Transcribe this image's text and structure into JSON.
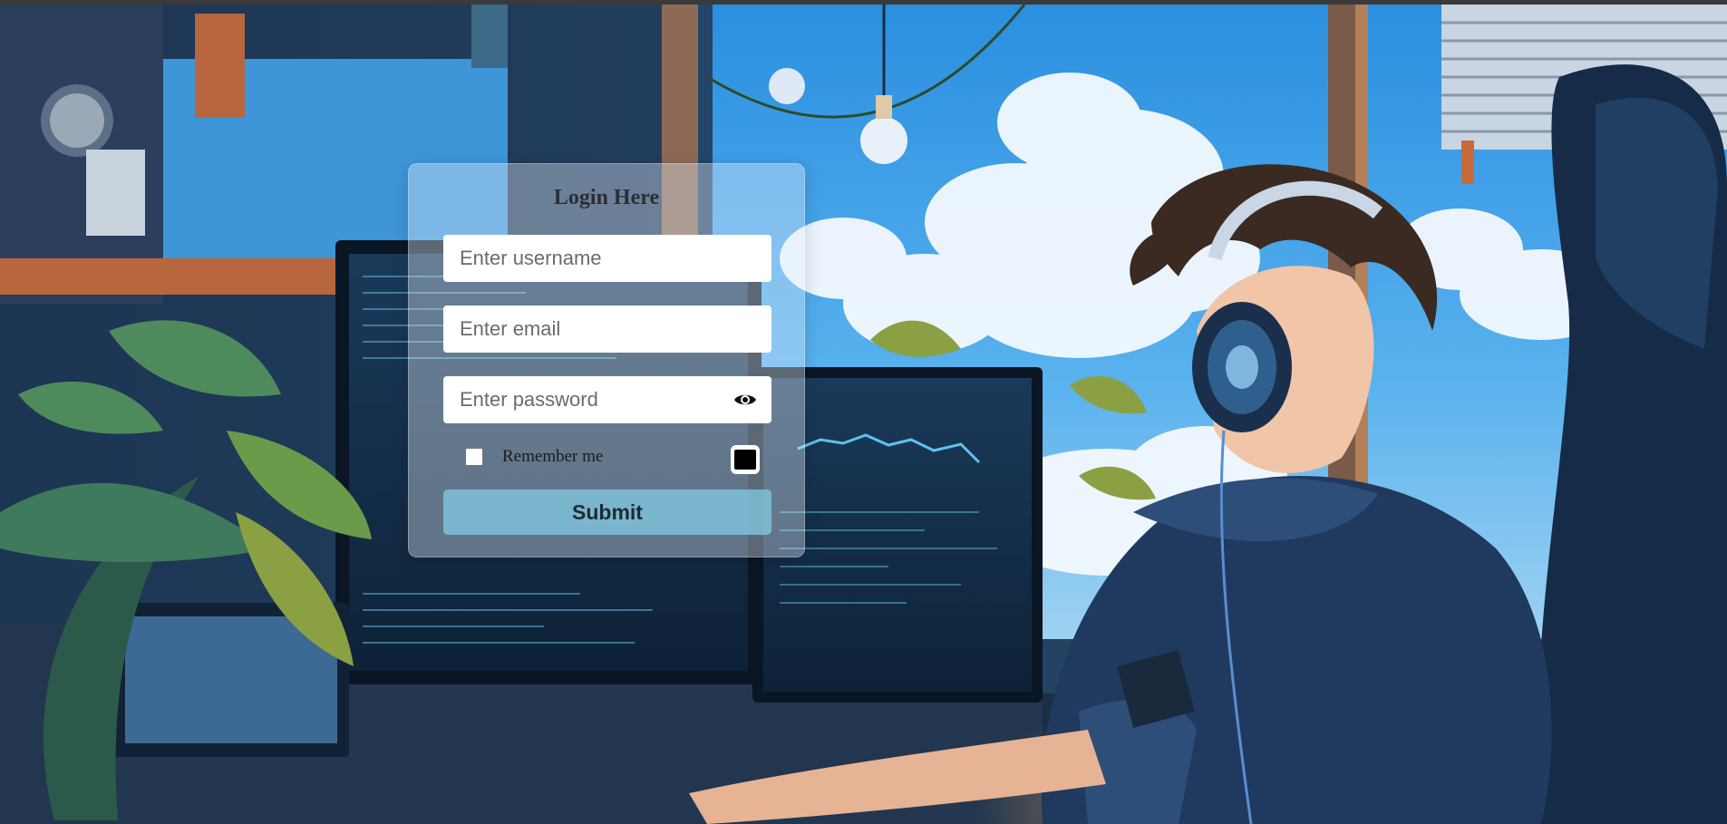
{
  "login": {
    "title": "Login Here",
    "username_placeholder": "Enter username",
    "email_placeholder": "Enter email",
    "password_placeholder": "Enter password",
    "remember_label": "Remember me",
    "submit_label": "Submit"
  },
  "icons": {
    "password_toggle": "eye-icon",
    "theme_toggle": "dark-mode-toggle"
  },
  "colors": {
    "card_background": "#e6f0fa",
    "submit_button": "#82c8e1",
    "input_background": "#ffffff",
    "title_text": "#2a2e35"
  }
}
